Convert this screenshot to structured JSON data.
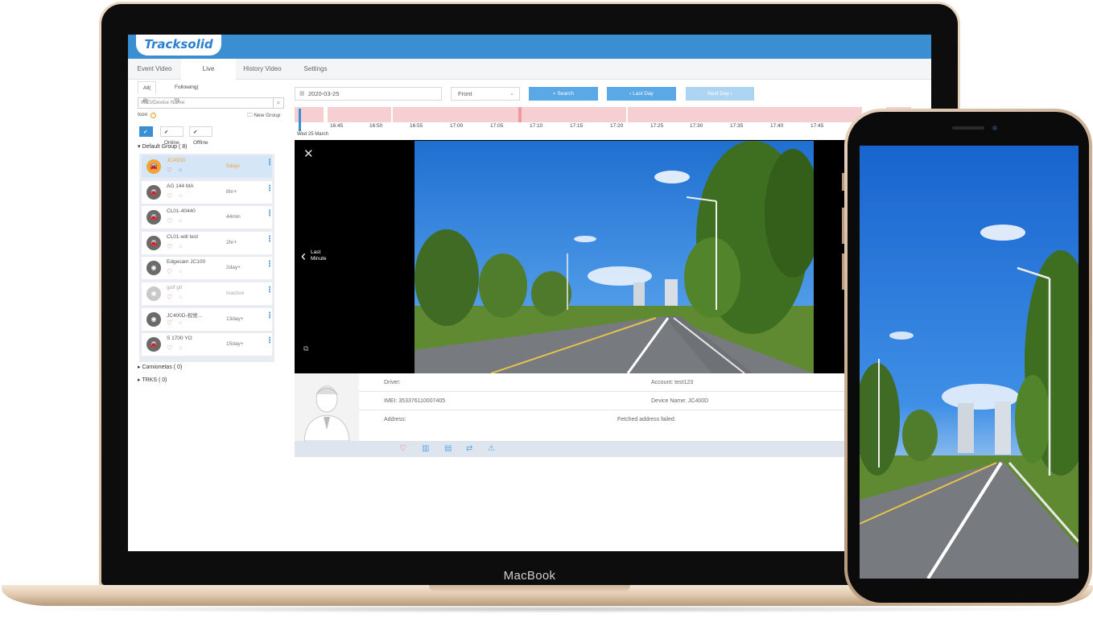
{
  "device_labels": {
    "laptop_brand": "MacBook"
  },
  "app": {
    "logo": "Tracksolid",
    "tabs": [
      {
        "label": "Event Video",
        "active": false
      },
      {
        "label": "Live",
        "active": true
      },
      {
        "label": "History Video",
        "active": false
      },
      {
        "label": "Settings",
        "active": false
      }
    ],
    "accent_color": "#3a8fd3"
  },
  "sidebar": {
    "subtabs": [
      {
        "label": "All( 8)",
        "active": true
      },
      {
        "label": "Following( 0)",
        "active": false
      }
    ],
    "search_placeholder": "IMEI/Device Name",
    "icon_label": "Icon",
    "new_group": "New Group",
    "filters": [
      {
        "label": "All",
        "active": true
      },
      {
        "label": "Online",
        "active": false
      },
      {
        "label": "Offline",
        "active": false
      }
    ],
    "default_group": {
      "name": "Default Group",
      "count": "( 8)"
    },
    "devices": [
      {
        "name": "JC400D",
        "time": "5days",
        "status": "selected"
      },
      {
        "name": "AG 144 MA",
        "time": "8hr+",
        "status": "online"
      },
      {
        "name": "CL01-40440",
        "time": "44min",
        "status": "online"
      },
      {
        "name": "CL01-will test",
        "time": "2hr+",
        "status": "online"
      },
      {
        "name": "Edgecam JC100",
        "time": "2day+",
        "status": "online"
      },
      {
        "name": "golf gti",
        "time": "Inactive",
        "status": "inactive"
      },
      {
        "name": "JC400D-视觉...",
        "time": "13day+",
        "status": "online"
      },
      {
        "name": "S 1700 YO",
        "time": "15day+",
        "status": "online"
      }
    ],
    "other_groups": [
      {
        "name": "Camionetas",
        "count": "( 0)"
      },
      {
        "name": "TRKS",
        "count": "( 0)"
      }
    ]
  },
  "controls": {
    "date": "2020-03-25",
    "camera": "Front",
    "search": "Search",
    "last_day": "Last Day",
    "next_day": "Next Day"
  },
  "timeline": {
    "ticks": [
      "16:45",
      "16:50",
      "16:55",
      "17:00",
      "17:05",
      "17:10",
      "17:15",
      "17:20",
      "17:25",
      "17:30",
      "17:35",
      "17:40",
      "17:45"
    ],
    "date_label": "Wed 25 March"
  },
  "player": {
    "last_minute": [
      "Last",
      "Minute"
    ]
  },
  "info": {
    "driver_label": "Driver:",
    "account": "Account: test123",
    "imei": "IMEI: 353376110007405",
    "device_name": "Device Name: JC400D",
    "address_label": "Address:",
    "address_value": "Fetched address failed."
  }
}
